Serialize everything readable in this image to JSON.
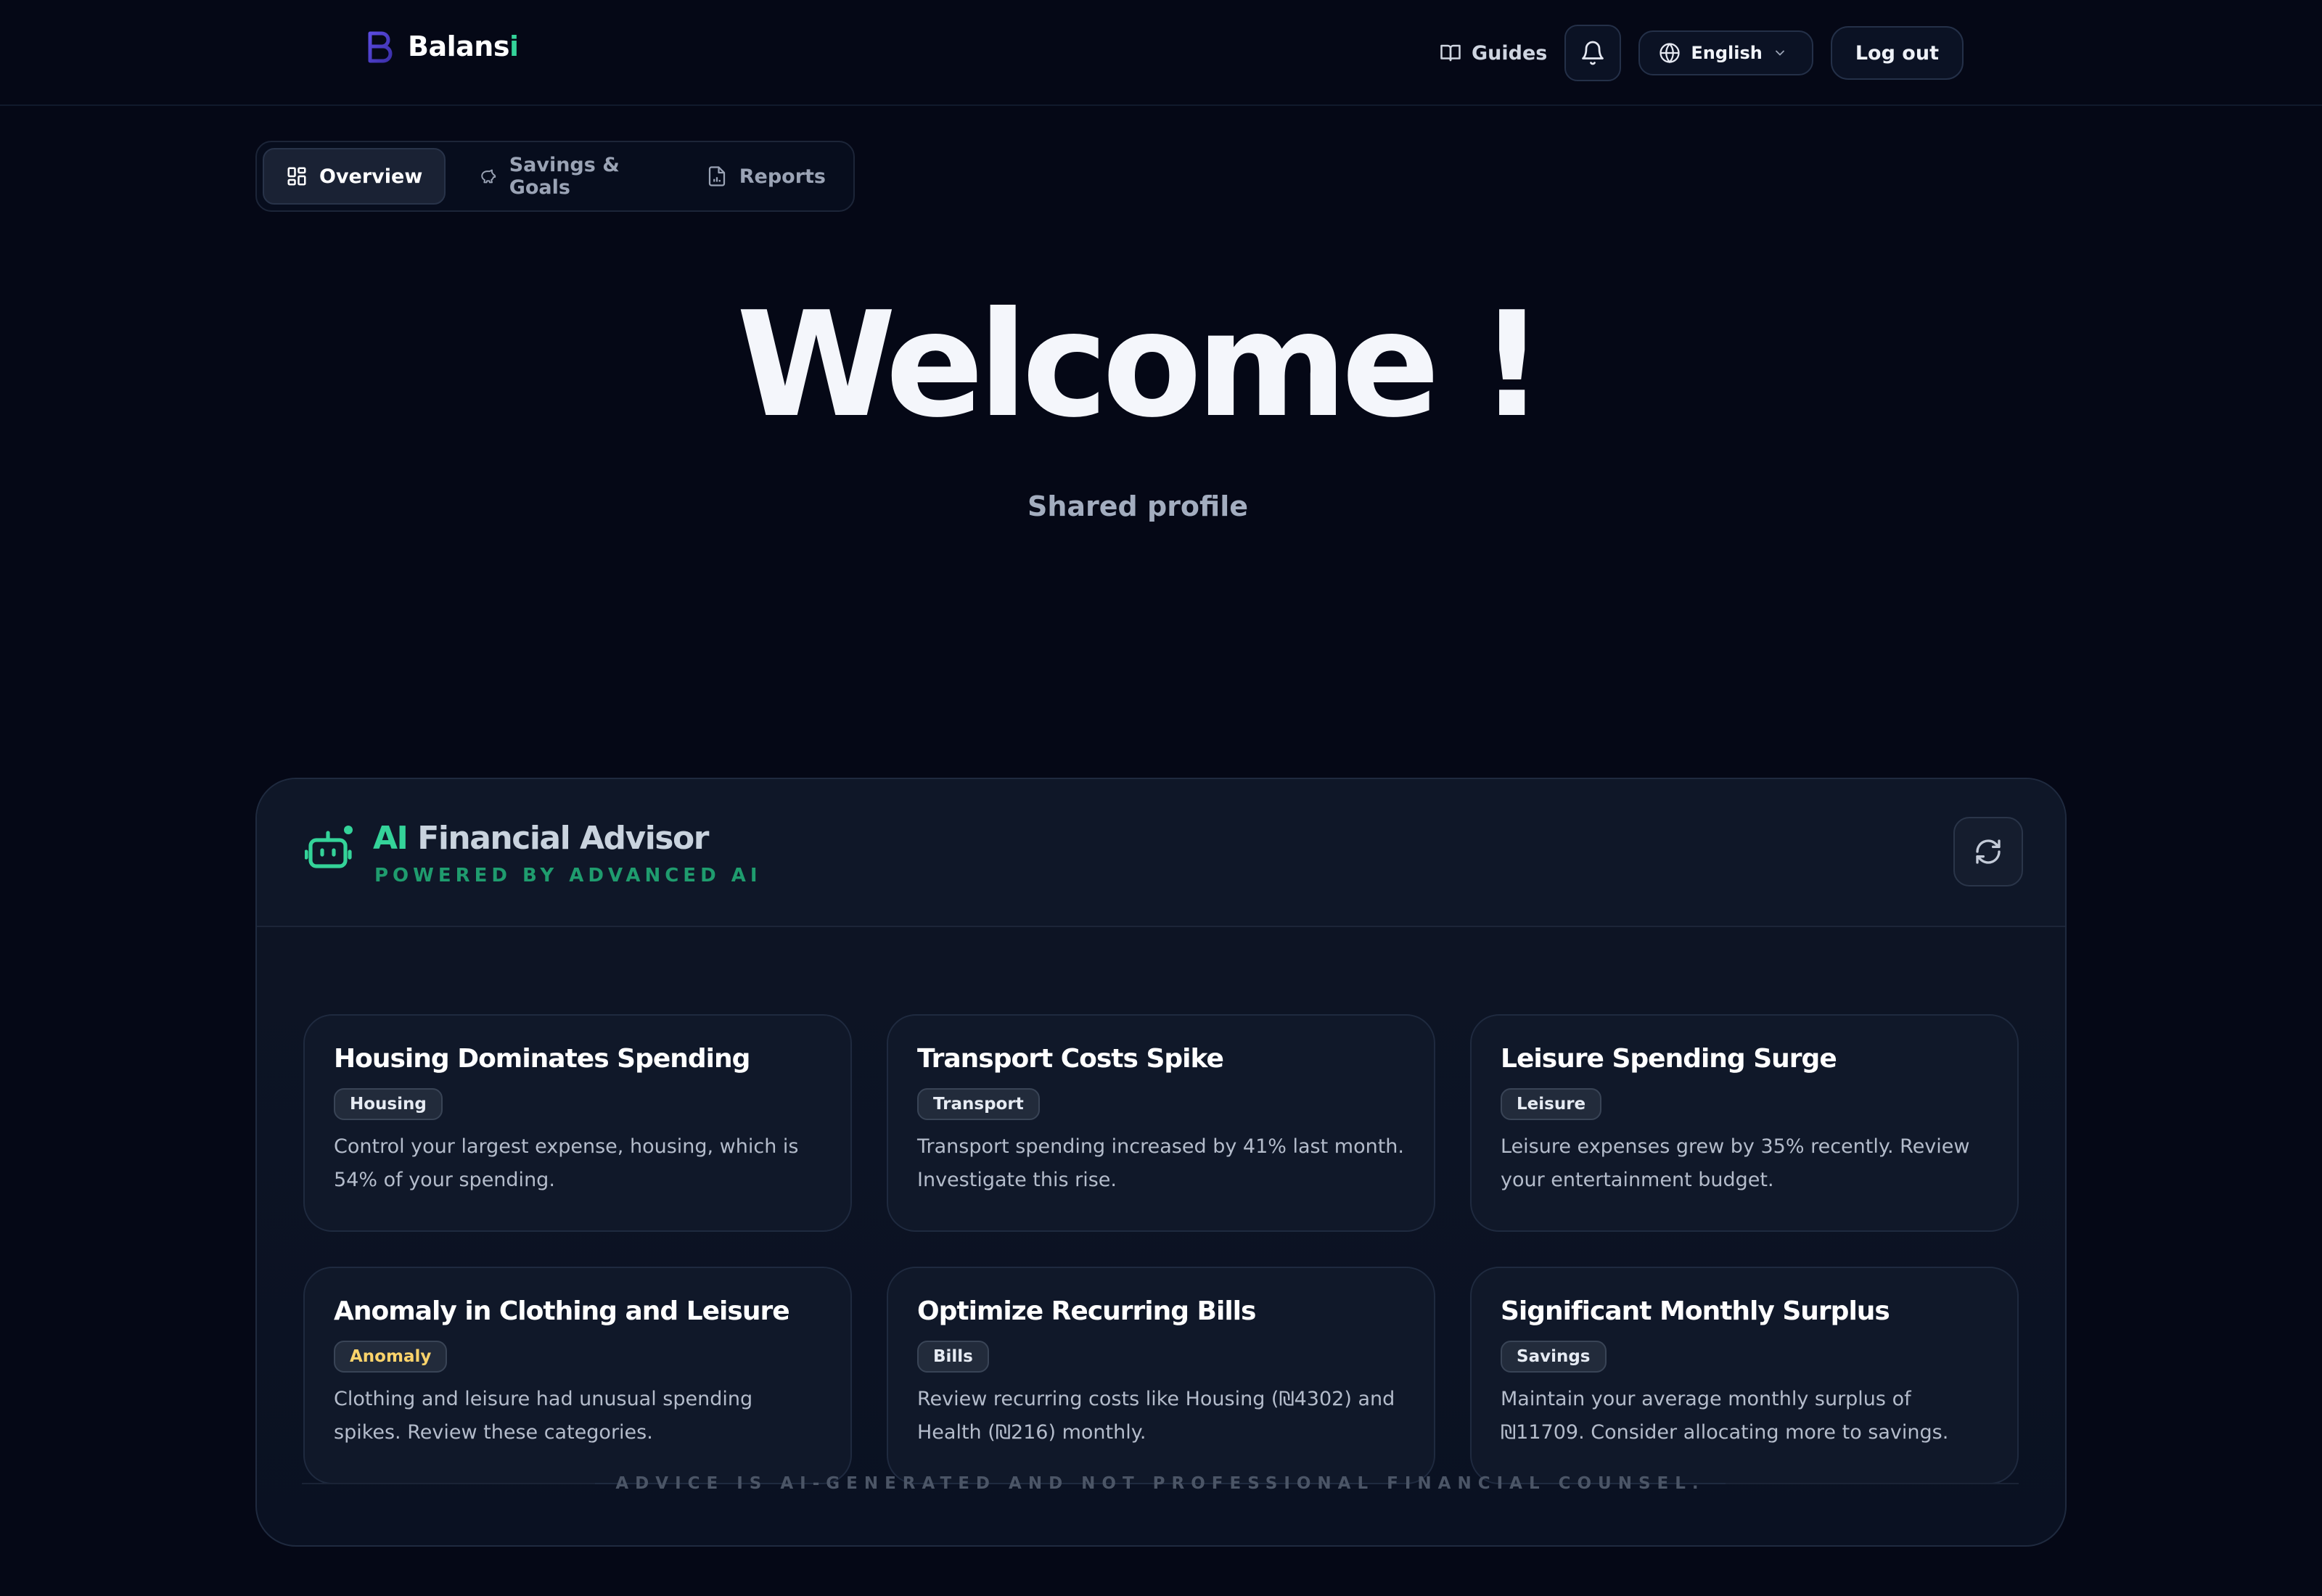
{
  "brand": {
    "name_main": "Balans",
    "name_accent": "i"
  },
  "header": {
    "guides_label": "Guides",
    "language_selected": "English",
    "logout_label": "Log out"
  },
  "tabs": [
    {
      "label": "Overview",
      "active": true,
      "icon": "grid-icon"
    },
    {
      "label": "Savings & Goals",
      "active": false,
      "icon": "piggy-bank-icon"
    },
    {
      "label": "Reports",
      "active": false,
      "icon": "report-file-icon"
    }
  ],
  "hero": {
    "title": "Welcome !",
    "subtitle": "Shared profile"
  },
  "advisor": {
    "title_ai": "AI",
    "title_rest": " Financial Advisor",
    "subtitle": "POWERED BY ADVANCED AI",
    "insights": [
      {
        "title": "Housing Dominates Spending",
        "tag": "Housing",
        "text": "Control your largest expense, housing, which is 54% of your spending."
      },
      {
        "title": "Transport Costs Spike",
        "tag": "Transport",
        "text": "Transport spending increased by 41% last month. Investigate this rise."
      },
      {
        "title": "Leisure Spending Surge",
        "tag": "Leisure",
        "text": "Leisure expenses grew by 35% recently. Review your entertainment budget."
      },
      {
        "title": "Anomaly in Clothing and Leisure",
        "tag": "Anomaly",
        "text": "Clothing and leisure had unusual spending spikes. Review these categories."
      },
      {
        "title": "Optimize Recurring Bills",
        "tag": "Bills",
        "text": "Review recurring costs like Housing (₪4302) and Health (₪216) monthly."
      },
      {
        "title": "Significant Monthly Surplus",
        "tag": "Savings",
        "text": "Maintain your average monthly surplus of ₪11709. Consider allocating more to savings."
      }
    ],
    "disclaimer": "ADVICE IS AI-GENERATED AND NOT PROFESSIONAL FINANCIAL COUNSEL."
  },
  "colors": {
    "background": "#050816",
    "accent": "#34d399",
    "anomaly_tag": "#fbd36b",
    "brand_mark": "#6d5cf6"
  }
}
